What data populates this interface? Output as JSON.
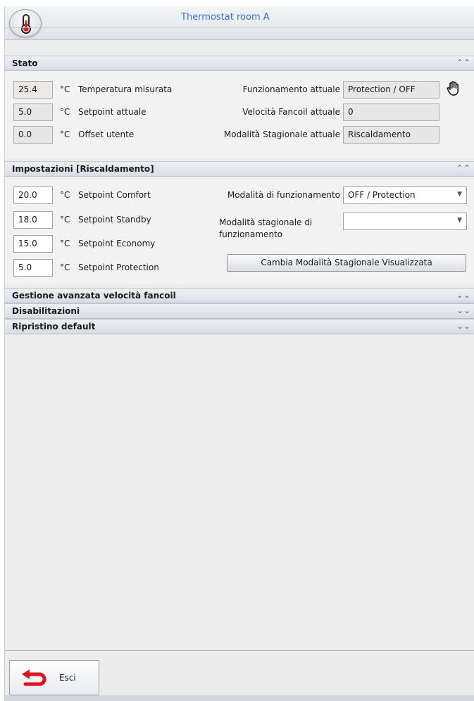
{
  "window": {
    "title": "Thermostat room A"
  },
  "sections": {
    "stato": {
      "title": "Stato"
    },
    "impostazioni": {
      "title": "Impostazioni [Riscaldamento]"
    },
    "gestione": {
      "title": "Gestione avanzata velocità fancoil"
    },
    "disabilitazioni": {
      "title": "Disabilitazioni"
    },
    "ripristino": {
      "title": "Ripristino default"
    }
  },
  "unit": "°C",
  "stato": {
    "temperatura": {
      "value": "25.4",
      "label": "Temperatura misurata"
    },
    "setpoint": {
      "value": "5.0",
      "label": "Setpoint attuale"
    },
    "offset": {
      "value": "0.0",
      "label": "Offset utente"
    },
    "funzionamento": {
      "label": "Funzionamento attuale",
      "value": "Protection / OFF"
    },
    "velocita": {
      "label": "Velocità Fancoil attuale",
      "value": "0"
    },
    "stagionale": {
      "label": "Modalità Stagionale attuale",
      "value": "Riscaldamento"
    }
  },
  "impostazioni": {
    "comfort": {
      "value": "20.0",
      "label": "Setpoint Comfort"
    },
    "standby": {
      "value": "18.0",
      "label": "Setpoint Standby"
    },
    "economy": {
      "value": "15.0",
      "label": "Setpoint Economy"
    },
    "protection": {
      "value": "5.0",
      "label": "Setpoint Protection"
    },
    "modalita_funz": {
      "label": "Modalità di funzionamento",
      "value": "OFF / Protection"
    },
    "modalita_stag": {
      "label_line1": "Modalità stagionale di",
      "label_line2": "funzionamento",
      "value": ""
    },
    "cambia_button": "Cambia Modalità Stagionale Visualizzata"
  },
  "footer": {
    "exit_label": "Esci"
  },
  "icons": {
    "app": "thermometer-icon",
    "hand": "hand-icon",
    "exit": "back-arrow-icon",
    "collapse": "double-chevron-up-icon",
    "expand": "double-chevron-down-icon"
  },
  "colors": {
    "title": "#3a6fd4",
    "exit_arrow": "#e0141e"
  }
}
